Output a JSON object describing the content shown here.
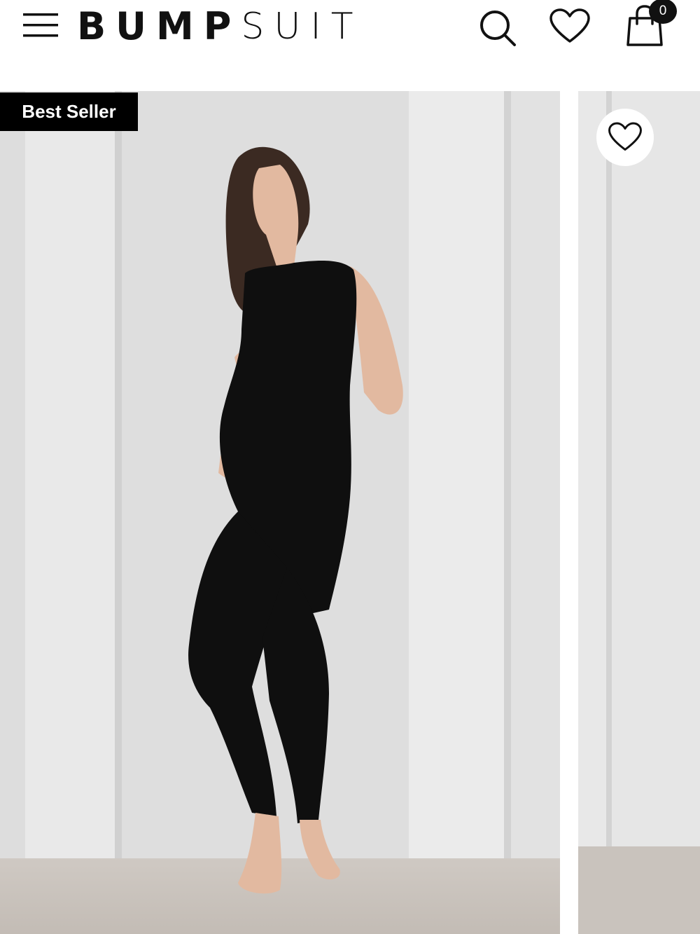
{
  "header": {
    "menu_icon": "hamburger-menu-icon",
    "logo_bold": "BUMP",
    "logo_light": "SUIT",
    "search_icon": "search-icon",
    "wishlist_icon": "heart-outline-icon",
    "cart_icon": "shopping-bag-icon",
    "cart_count": "0"
  },
  "gallery": {
    "badge": "Best Seller",
    "favorite_icon": "heart-outline-icon",
    "main_image": "pregnant-model-black-bodysuit-photo",
    "next_image": "next-product-photo-partial"
  },
  "colors": {
    "text": "#111111",
    "badge_bg": "#000000",
    "badge_text": "#ffffff",
    "wall": "#dcdcdc",
    "floor": "#c8c2bc"
  }
}
